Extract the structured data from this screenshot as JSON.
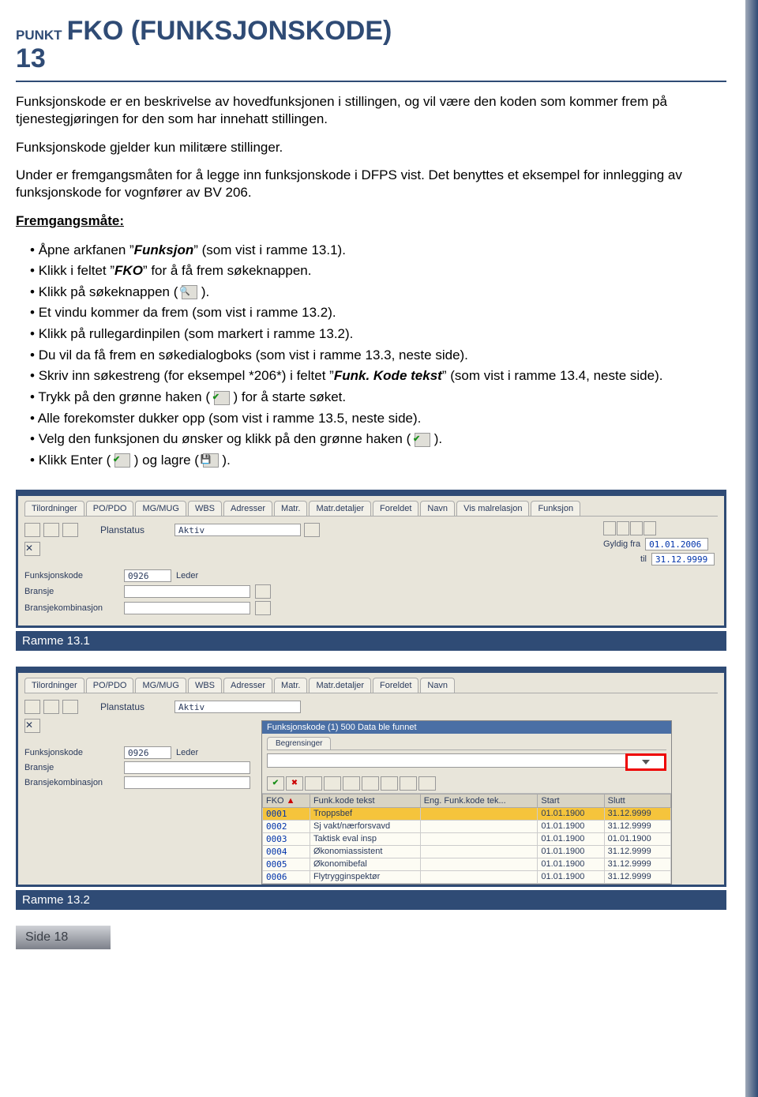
{
  "header": {
    "punkt_label": "PUNKT",
    "punkt_number": "13",
    "title": "FKO (FUNKSJONSKODE)"
  },
  "paras": {
    "p1": "Funksjonskode er en beskrivelse av hovedfunksjonen i stillingen, og vil være den koden som kommer frem på tjenestegjøringen for den som har innehatt stillingen.",
    "p2": "Funksjonskode gjelder kun militære stillinger.",
    "p3": "Under er fremgangsmåten for å legge inn funksjonskode i DFPS vist. Det benyttes et eksempel for innlegging av funksjonskode for vognfører av BV 206.",
    "fremgang_label": "Fremgangsmåte:"
  },
  "bullets": {
    "b1a": "Åpne arkfanen ”",
    "b1b": "Funksjon",
    "b1c": "” (som vist i ramme 13.1).",
    "b2a": "Klikk i feltet ”",
    "b2b": "FKO",
    "b2c": "” for å få frem søkeknappen.",
    "b3a": "Klikk på søkeknappen ( ",
    "b3b": " ).",
    "b4": "Et vindu kommer da frem (som vist i ramme 13.2).",
    "b5": "Klikk på rullegardinpilen (som markert i ramme 13.2).",
    "b6": "Du vil da få frem en søkedialogboks (som vist i ramme 13.3, neste side).",
    "b7a": "Skriv inn søkestreng (for eksempel *206*) i feltet ”",
    "b7b": "Funk. Kode tekst",
    "b7c": "” (som vist i ramme 13.4, neste side).",
    "b8a": "Trykk på den grønne haken ( ",
    "b8b": " ) for å starte søket.",
    "b9": "Alle forekomster dukker opp (som vist i ramme 13.5, neste side).",
    "b10a": "Velg den funksjonen du ønsker og klikk på den grønne haken ( ",
    "b10b": " ).",
    "b11a": "Klikk Enter ( ",
    "b11b": " ) og lagre ( ",
    "b11c": " )."
  },
  "frame1": {
    "caption": "Ramme 13.1",
    "tabs": [
      "Tilordninger",
      "PO/PDO",
      "MG/MUG",
      "WBS",
      "Adresser",
      "Matr.",
      "Matr.detaljer",
      "Foreldet",
      "Navn",
      "Vis malrelasjon",
      "Funksjon"
    ],
    "fields": {
      "planstatus_lbl": "Planstatus",
      "planstatus_val": "Aktiv",
      "gyldig_fra_lbl": "Gyldig fra",
      "gyldig_fra_val": "01.01.2006",
      "til_lbl": "til",
      "til_val": "31.12.9999",
      "fko_lbl": "Funksjonskode",
      "fko_code": "0926",
      "fko_text": "Leder",
      "bransje_lbl": "Bransje",
      "bransjekomb_lbl": "Bransjekombinasjon"
    }
  },
  "frame2": {
    "caption": "Ramme 13.2",
    "tabs": [
      "Tilordninger",
      "PO/PDO",
      "MG/MUG",
      "WBS",
      "Adresser",
      "Matr.",
      "Matr.detaljer",
      "Foreldet",
      "Navn"
    ],
    "popup_title": "Funksjonskode (1)  500 Data ble funnet",
    "popup_tab": "Begrensinger",
    "headers": [
      "FKO",
      "Funk.kode tekst",
      "Eng. Funk.kode tek...",
      "Start",
      "Slutt"
    ],
    "rows": [
      {
        "fko": "0001",
        "txt": "Troppsbef",
        "eng": "",
        "start": "01.01.1900",
        "slutt": "31.12.9999",
        "sel": true
      },
      {
        "fko": "0002",
        "txt": "Sj vakt/nærforsvavd",
        "eng": "",
        "start": "01.01.1900",
        "slutt": "31.12.9999"
      },
      {
        "fko": "0003",
        "txt": "Taktisk eval insp",
        "eng": "",
        "start": "01.01.1900",
        "slutt": "01.01.1900"
      },
      {
        "fko": "0004",
        "txt": "Økonomiassistent",
        "eng": "",
        "start": "01.01.1900",
        "slutt": "31.12.9999"
      },
      {
        "fko": "0005",
        "txt": "Økonomibefal",
        "eng": "",
        "start": "01.01.1900",
        "slutt": "31.12.9999"
      },
      {
        "fko": "0006",
        "txt": "Flytrygginspektør",
        "eng": "",
        "start": "01.01.1900",
        "slutt": "31.12.9999"
      }
    ]
  },
  "footer": {
    "page": "Side 18"
  }
}
